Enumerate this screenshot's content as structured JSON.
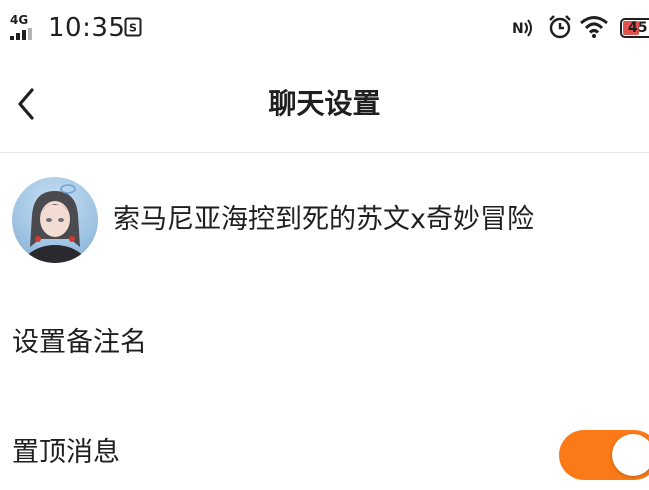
{
  "status_bar": {
    "network": "4G",
    "time": "10:35",
    "battery": "45",
    "icons": [
      "signal-icon",
      "sim-icon",
      "nfc-icon",
      "alarm-icon",
      "wifi-icon",
      "battery-icon"
    ]
  },
  "nav": {
    "title": "聊天设置",
    "back_icon": "chevron-left-icon"
  },
  "profile": {
    "name": "索马尼亚海控到死的苏文x奇妙冒险",
    "avatar": "avatar"
  },
  "settings": {
    "remark_label": "设置备注名",
    "pin_label": "置顶消息",
    "pin_enabled": true
  },
  "colors": {
    "accent": "#fb7a17",
    "battery_low": "#e0524c",
    "divider": "#e6e6e6"
  }
}
